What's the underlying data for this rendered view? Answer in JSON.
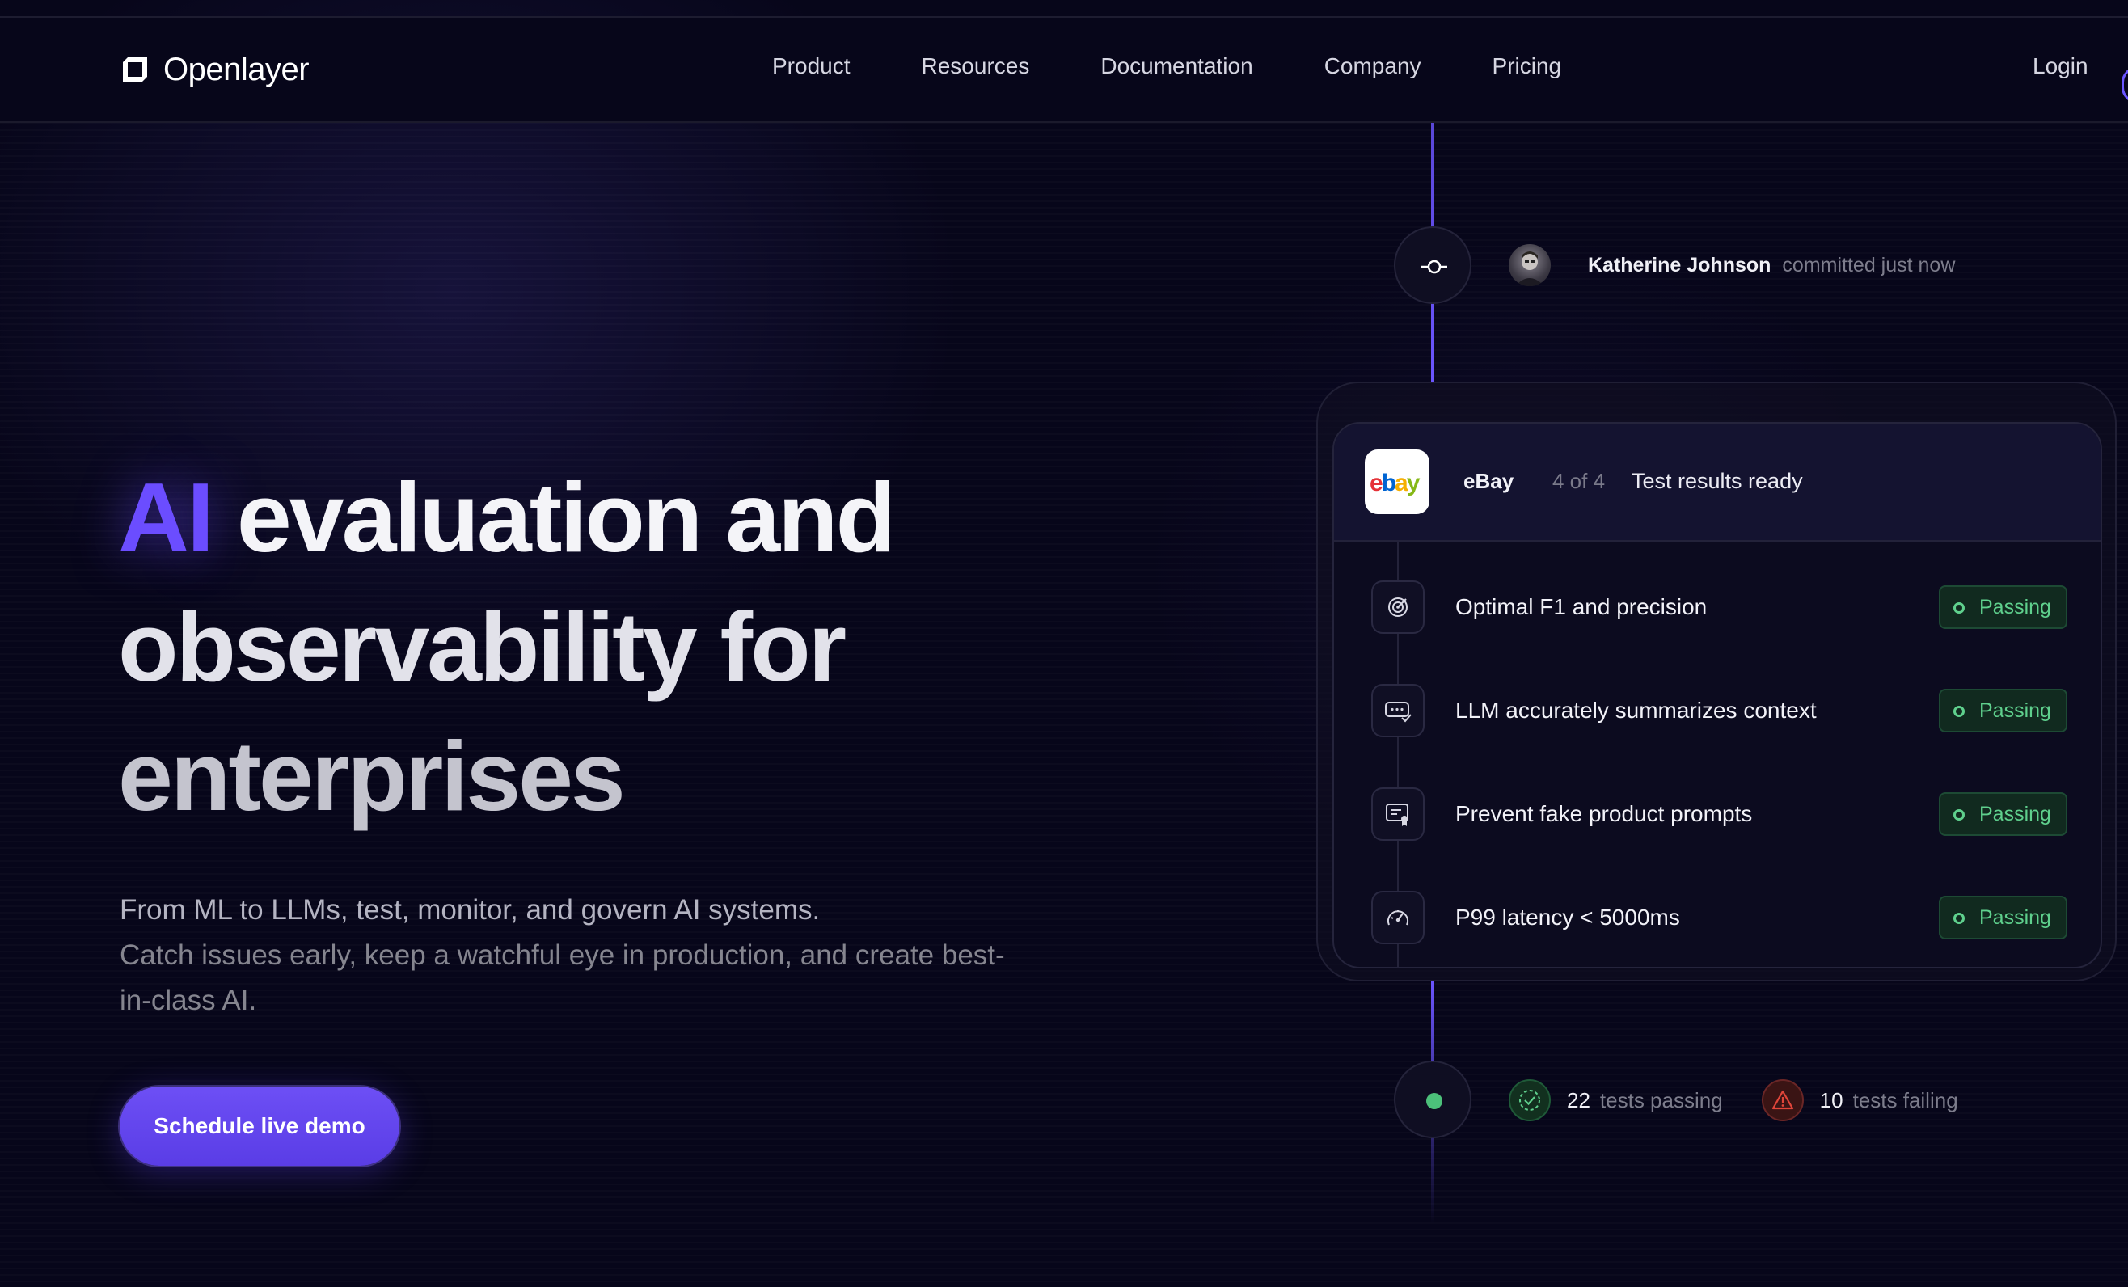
{
  "brand": {
    "name": "Openlayer"
  },
  "nav": {
    "links": [
      "Product",
      "Resources",
      "Documentation",
      "Company",
      "Pricing"
    ],
    "login": "Login"
  },
  "hero": {
    "headline_accent": "AI",
    "headline_line1": "evaluation and",
    "headline_line2": "observability for",
    "headline_line3": "enterprises",
    "subtitle_line1": "From ML to LLMs, test, monitor, and govern AI systems.",
    "subtitle_line2": "Catch issues early, keep a watchful eye in production, and create best-in-class AI.",
    "cta_label": "Schedule live demo"
  },
  "commit": {
    "author": "Katherine Johnson",
    "meta": "committed just now"
  },
  "card": {
    "project_logo": "ebay",
    "project_name": "eBay",
    "count": "4 of 4",
    "status": "Test results ready",
    "tests": [
      {
        "icon": "target-icon",
        "label": "Optimal F1 and precision",
        "status": "Passing"
      },
      {
        "icon": "chat-check-icon",
        "label": "LLM accurately summarizes context",
        "status": "Passing"
      },
      {
        "icon": "certificate-icon",
        "label": "Prevent fake product prompts",
        "status": "Passing"
      },
      {
        "icon": "gauge-icon",
        "label": "P99 latency < 5000ms",
        "status": "Passing"
      }
    ]
  },
  "summary": {
    "passing_count": "22",
    "passing_label": "tests passing",
    "failing_count": "10",
    "failing_label": "tests failing"
  },
  "colors": {
    "accent": "#6b4dff",
    "background": "#07061a",
    "passing": "#5fd08d",
    "failing": "#e0453a"
  }
}
